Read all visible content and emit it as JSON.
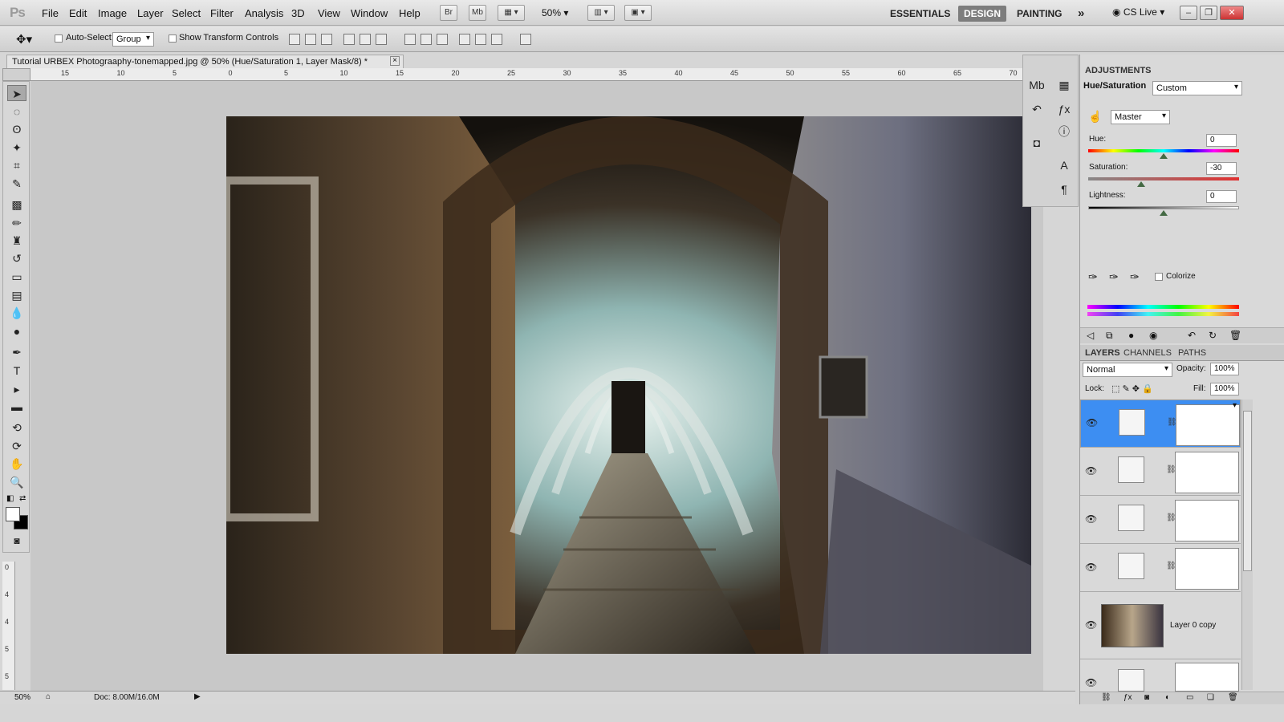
{
  "app": {
    "logo": "Ps"
  },
  "menubar": {
    "items": [
      "File",
      "Edit",
      "Image",
      "Layer",
      "Select",
      "Filter",
      "Analysis",
      "3D",
      "View",
      "Window",
      "Help"
    ],
    "bridge": "Br",
    "minibridge": "Mb",
    "zoom": "50%",
    "workspaces": [
      "ESSENTIALS",
      "DESIGN",
      "PAINTING"
    ],
    "more": "»",
    "cslive": "CS Live"
  },
  "options": {
    "autoselect_label": "Auto-Select:",
    "autoselect_value": "Group",
    "transform_label": "Show Transform Controls"
  },
  "document": {
    "tab_title": "Tutorial URBEX Photograaphy-tonemapped.jpg @ 50% (Hue/Saturation 1, Layer Mask/8) *",
    "close": "×"
  },
  "ruler": {
    "h_ticks": [
      "15",
      "10",
      "5",
      "0",
      "5",
      "10",
      "15",
      "20",
      "25",
      "30",
      "35",
      "40",
      "45",
      "50",
      "55",
      "60",
      "65",
      "70"
    ],
    "v_ticks": [
      "0",
      "4",
      "4",
      "5",
      "5"
    ]
  },
  "status": {
    "zoom": "50%",
    "doc": "Doc: 8.00M/16.0M"
  },
  "adjustments": {
    "tab": "ADJUSTMENTS",
    "title": "Hue/Saturation",
    "preset": "Custom",
    "channel": "Master",
    "hue_label": "Hue:",
    "hue": "0",
    "sat_label": "Saturation:",
    "sat": "-30",
    "light_label": "Lightness:",
    "light": "0",
    "colorize_label": "Colorize",
    "hue_level": 0.5,
    "sat_level": 0.35,
    "light_level": 0.5
  },
  "layers": {
    "tabs": [
      "LAYERS",
      "CHANNELS",
      "PATHS"
    ],
    "blend": "Normal",
    "opacity_label": "Opacity:",
    "opacity": "100%",
    "lock_label": "Lock:",
    "fill_label": "Fill:",
    "fill": "100%",
    "layer0_name": "Layer 0 copy"
  },
  "colors": {
    "accent": "#3d8ef2",
    "panel": "#d9d9d9"
  }
}
